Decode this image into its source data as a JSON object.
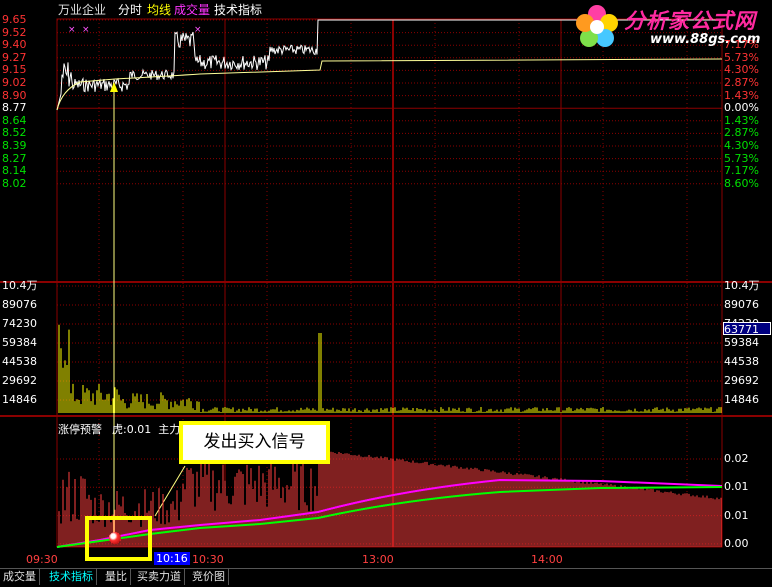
{
  "header": {
    "stock_name": "万业企业",
    "menu": [
      "分时",
      "均线",
      "成交量",
      "技术指标"
    ],
    "menu_colors": [
      "#ffffff",
      "#ffff00",
      "#ff33ff",
      "#ffffff"
    ]
  },
  "logo": {
    "name": "分析家公式网",
    "url": "www.88gs.com"
  },
  "price_axis": {
    "left_labels": [
      "9.65",
      "9.52",
      "9.40",
      "9.27",
      "9.15",
      "9.02",
      "8.90",
      "8.77",
      "8.64",
      "8.52",
      "8.39",
      "8.27",
      "8.14",
      "8.02"
    ],
    "right_labels": [
      "",
      "",
      "7.17%",
      "5.73%",
      "4.30%",
      "2.87%",
      "1.43%",
      "0.00%",
      "1.43%",
      "2.87%",
      "4.30%",
      "5.73%",
      "7.17%",
      "8.60%"
    ]
  },
  "volume_axis": {
    "left_labels": [
      "10.4万",
      "89076",
      "74230",
      "59384",
      "44538",
      "29692",
      "14846"
    ],
    "right_labels": [
      "10.4万",
      "89076",
      "74230",
      "59384",
      "44538",
      "29692",
      "14846"
    ],
    "current_value": "63771"
  },
  "indicator": {
    "title": "涨停预警",
    "params": "虎:0.01  主力:0.01  散户:0.01",
    "right_labels": [
      "0.02",
      "0.01",
      "0.01",
      "0.00"
    ]
  },
  "signal_label": "发出买入信号",
  "time_axis": {
    "labels": [
      "09:30",
      "10:30",
      "13:00",
      "14:00"
    ],
    "highlight": "10:16"
  },
  "bottom_tabs": [
    "成交量",
    "技术指标",
    "量比",
    "买卖力道",
    "竞价图"
  ],
  "active_tab": 1,
  "colors": {
    "grid": "#8b0000",
    "price_up": "#ff3333",
    "price_down": "#00e000",
    "price_line": "#ffffff",
    "avg_line": "#ffff99",
    "volume_bar": "#ffff00",
    "indicator_bar": "#ff4040",
    "magenta_line": "#ff00ff",
    "green_line": "#00ff00"
  }
}
